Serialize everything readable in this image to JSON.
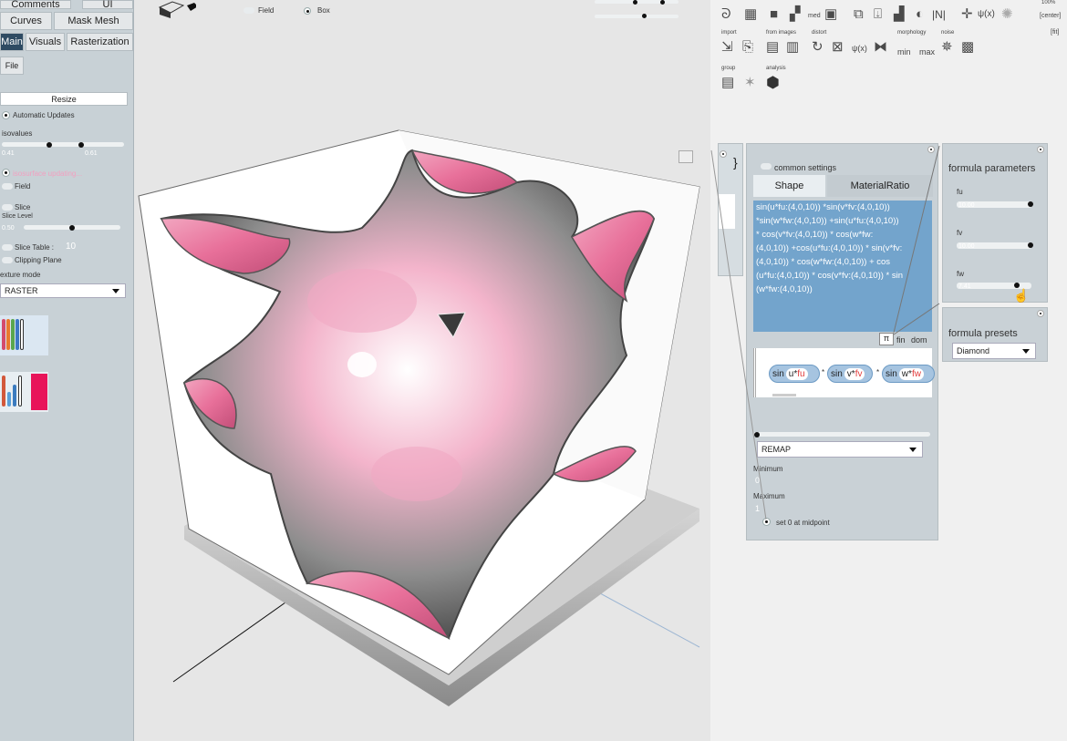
{
  "left_panel": {
    "top_tabs": [
      "Comments",
      "UI"
    ],
    "tabs_row2": [
      "Curves",
      "Mask Mesh"
    ],
    "tabs_row3": [
      "Main",
      "Visuals",
      "Rasterization"
    ],
    "file_button": "File",
    "resize_button": "Resize",
    "automatic_updates": "Automatic Updates",
    "isovalues_label": "isovalues",
    "isovalue_low": "0.41",
    "isovalue_high": "0.61",
    "updating_text": "isosurface updating...",
    "field_label": "Field",
    "slice_label": "Slice",
    "slice_level_label": "Slice Level",
    "slice_level_value": "0.50",
    "slice_table_label": "Slice Table :",
    "slice_table_value": "10",
    "clipping_plane_label": "Clipping Plane",
    "texture_mode_label": "exture mode",
    "texture_mode_value": "RASTER"
  },
  "viewport_header": {
    "field_label": "Field",
    "box_label": "Box"
  },
  "toolbar": {
    "groups": {
      "import": "import",
      "from_images": "from images",
      "distort": "distort",
      "morphology": "morphology",
      "noise": "noise",
      "group": "group",
      "analysis": "analysis"
    },
    "icons": {
      "med": "med",
      "min": "min",
      "max": "max",
      "abs": "|N|",
      "psi_x": "ψ(x)",
      "psi_x2": "ψ(x)",
      "pi": "π"
    },
    "right_labels": {
      "center": "[center]",
      "fit": "[fit]",
      "pct": "100%"
    }
  },
  "formula_card": {
    "brace": "}",
    "common_settings": "common settings",
    "tab_shape": "Shape",
    "tab_material": "MaterialRatio",
    "formula_lines": [
      "sin(u*fu:(4,0,10)) *sin(v*fv:(4,0,10))",
      "*sin(w*fw:(4,0,10)) +sin(u*fu:(4,0,10))",
      "* cos(v*fv:(4,0,10)) * cos(w*fw:",
      "(4,0,10)) +cos(u*fu:(4,0,10)) * sin(v*fv:",
      "(4,0,10)) * cos(w*fw:(4,0,10)) + cos",
      "(u*fu:(4,0,10)) * cos(v*fv:(4,0,10)) * sin",
      "(w*fw:(4,0,10))"
    ],
    "footer_pi": "π",
    "footer_fin": "fin",
    "footer_dom": "dom",
    "pills": [
      {
        "fn": "sin",
        "var": "u",
        "param": "fu"
      },
      {
        "fn": "sin",
        "var": "v",
        "param": "fv"
      },
      {
        "fn": "sin",
        "var": "w",
        "param": "fw"
      }
    ],
    "remap_value": "REMAP",
    "minimum_label": "Minimum",
    "minimum_value": "0",
    "maximum_label": "Maximum",
    "maximum_value": "1",
    "midpoint_label": "set 0 at midpoint"
  },
  "params_card": {
    "title": "formula parameters",
    "params": [
      {
        "name": "fu",
        "value": "10.00",
        "fraction": 1.0
      },
      {
        "name": "fv",
        "value": "10.00",
        "fraction": 1.0
      },
      {
        "name": "fw",
        "value": "7.41",
        "fraction": 0.74
      }
    ]
  },
  "presets_card": {
    "title": "formula presets",
    "selected": "Diamond"
  },
  "colors": {
    "accent_dark": "#2e4b63",
    "formula_blue": "#73a4cc",
    "surface_pink": "#e8709a"
  }
}
